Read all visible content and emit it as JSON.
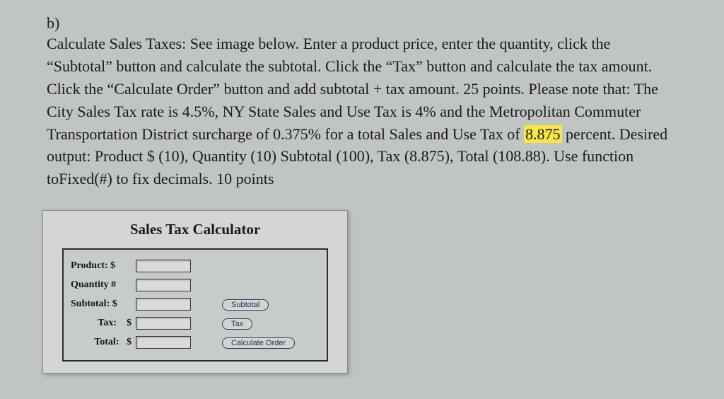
{
  "question": {
    "label": "b)",
    "text_parts": {
      "p1": "Calculate Sales Taxes: See image below. Enter a product price, enter the quantity, click the “Subtotal” button and calculate the subtotal. Click the “Tax” button and calculate the tax amount. Click the “Calculate Order” button and add subtotal + tax amount. 25 points. Please note that: The City Sales Tax rate is 4.5%, NY State Sales and Use Tax is 4% and the Metropolitan Commuter Transportation District surcharge of 0.375% for a total Sales and Use Tax of ",
      "highlight": "8.875",
      "p2": " percent. Desired output: Product $ (10), Quantity (10) Subtotal (100), Tax (8.875), Total (108.88). Use function toFixed(#) to fix decimals. 10 points"
    }
  },
  "calculator": {
    "title": "Sales Tax Calculator",
    "labels": {
      "product": "Product: $",
      "quantity": "Quantity #",
      "subtotal": "Subtotal: $",
      "tax": "Tax:    $",
      "total": "Total:   $"
    },
    "buttons": {
      "subtotal": "Subtotal",
      "tax": "Tax",
      "calculate": "Calculate Order"
    },
    "values": {
      "product": "",
      "quantity": "",
      "subtotal": "",
      "tax": "",
      "total": ""
    }
  }
}
